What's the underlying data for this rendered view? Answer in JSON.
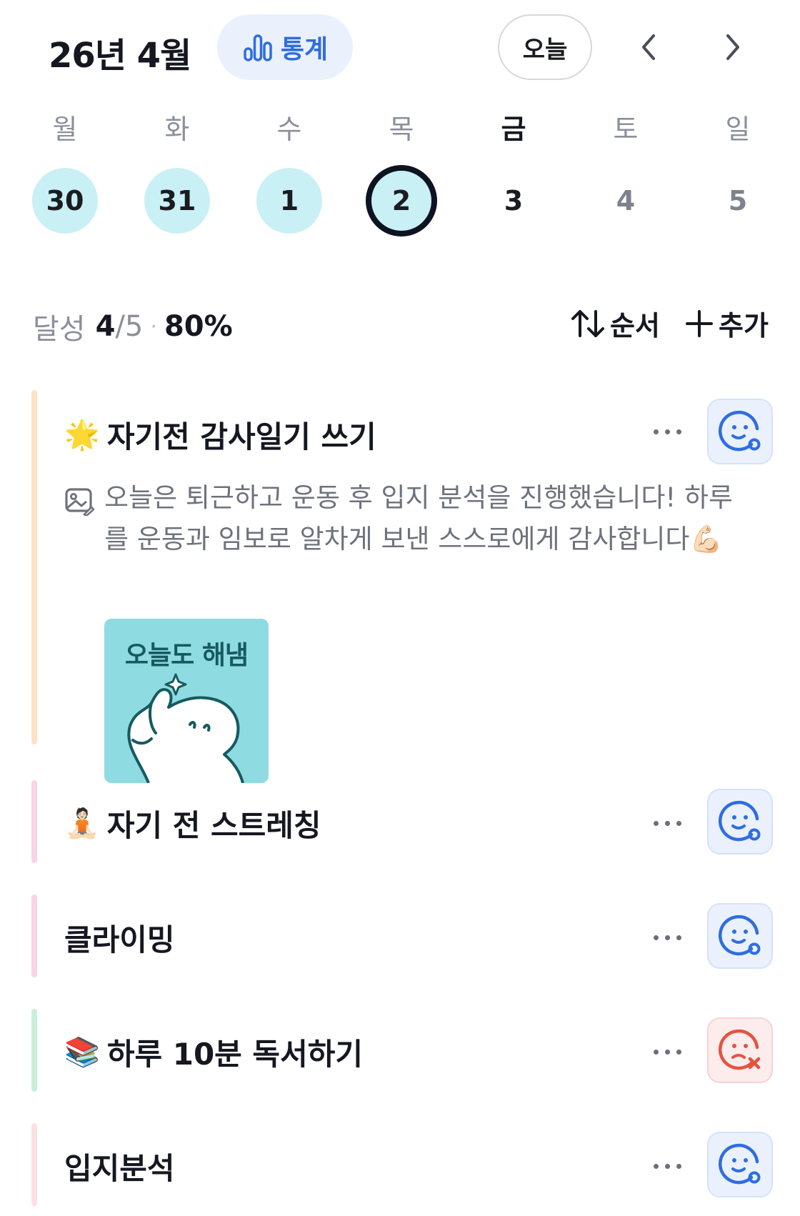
{
  "header": {
    "month_title": "26년 4월",
    "stats_label": "통계",
    "today_label": "오늘",
    "prev_icon": "chevron-left-icon",
    "next_icon": "chevron-right-icon"
  },
  "week": {
    "weekdays": [
      "월",
      "화",
      "수",
      "목",
      "금",
      "토",
      "일"
    ],
    "dates": [
      "30",
      "31",
      "1",
      "2",
      "3",
      "4",
      "5"
    ],
    "states": [
      "done",
      "done",
      "done",
      "selected",
      "future",
      "weekend",
      "weekend"
    ]
  },
  "summary": {
    "label": "달성",
    "count": "4",
    "total": "/5",
    "percent": "80%",
    "sort_label": "순서",
    "add_label": "추가"
  },
  "habits": [
    {
      "emoji": "🌟",
      "title": "자기전 감사일기 쓰기",
      "note": "오늘은 퇴근하고 운동 후 입지 분석을 진행했습니다! 하루를 운동과 임보로 알차게 보낸 스스로에게 감사합니다💪🏻",
      "sticker_text": "오늘도 해냄",
      "status": "done",
      "color": "#fde3c4"
    },
    {
      "emoji": "🧘🏻",
      "title": "자기 전 스트레칭",
      "status": "done",
      "color": "#fbd3e6"
    },
    {
      "emoji": "",
      "title": "클라이밍",
      "status": "done",
      "color": "#fbd3e6"
    },
    {
      "emoji": "📚",
      "title": "하루 10분 독서하기",
      "status": "failed",
      "color": "#c9efd9"
    },
    {
      "emoji": "",
      "title": "입지분석",
      "status": "done",
      "color": "#fde0e2"
    }
  ],
  "colors": {
    "accent": "#2f6de0",
    "fail": "#e5533f",
    "done_circle": "#c9f0f4"
  }
}
